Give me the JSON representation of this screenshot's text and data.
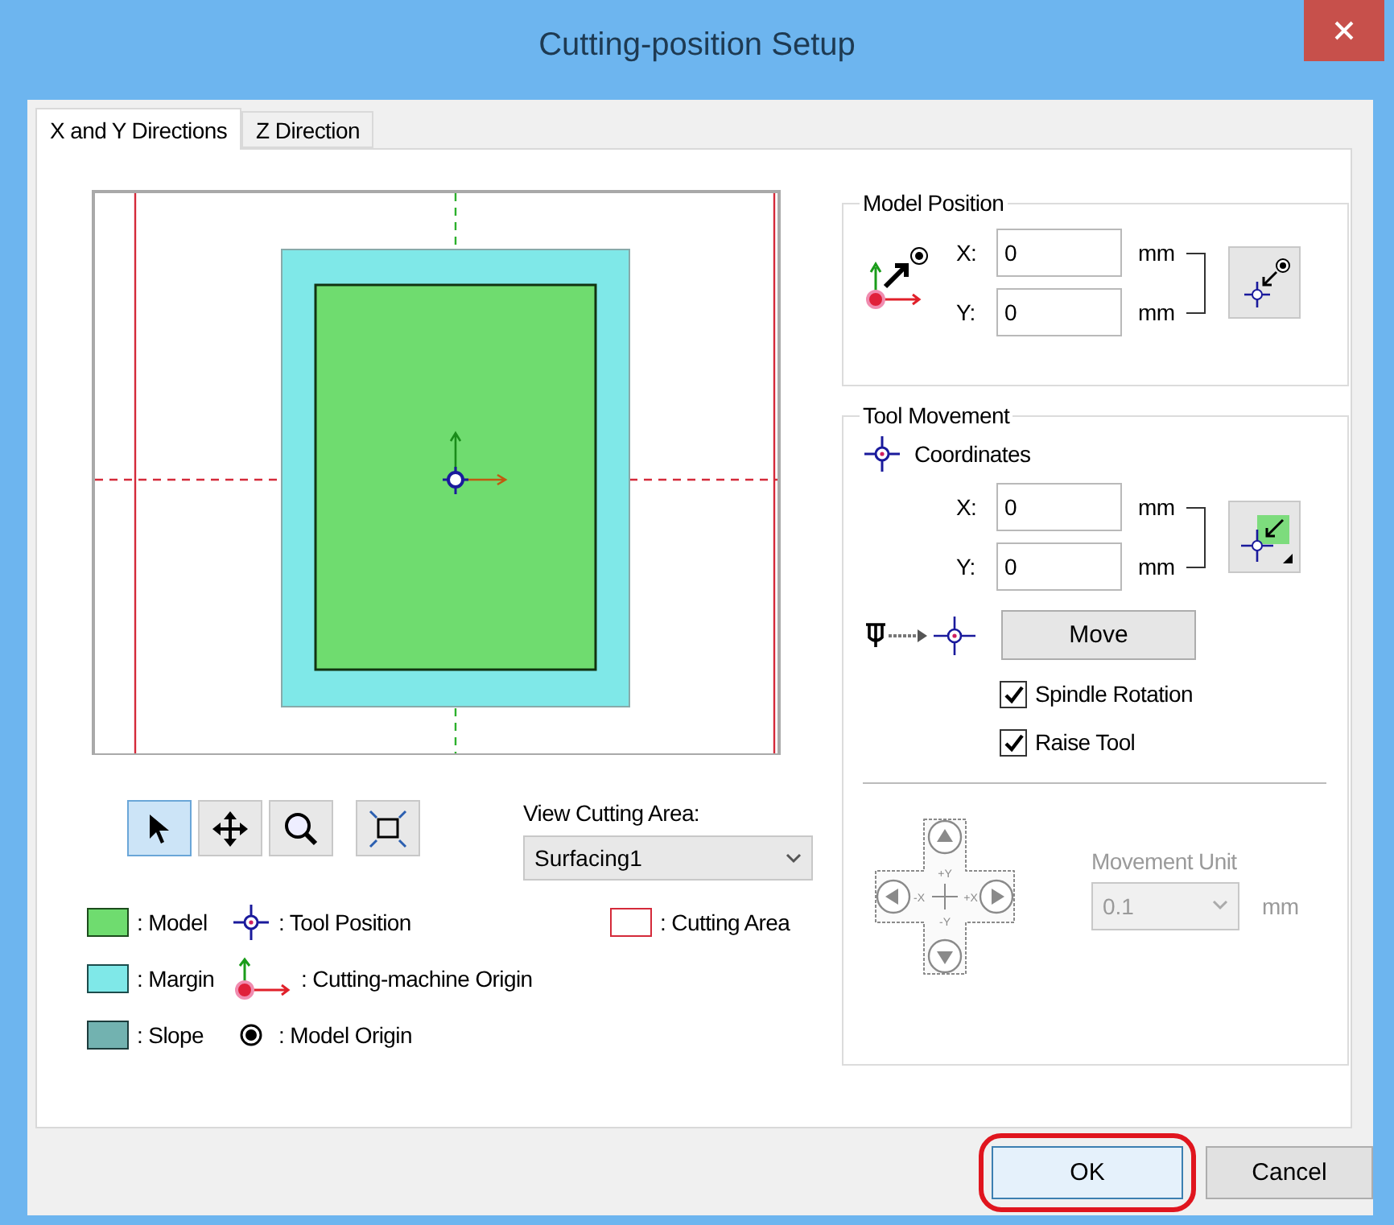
{
  "window": {
    "title": "Cutting-position Setup"
  },
  "tabs": [
    {
      "label": "X and Y Directions",
      "selected": true
    },
    {
      "label": "Z Direction",
      "selected": false
    }
  ],
  "view_tools": [
    {
      "kind": "pointer",
      "selected": true
    },
    {
      "kind": "pan",
      "selected": false
    },
    {
      "kind": "zoom",
      "selected": false
    },
    {
      "kind": "fit",
      "selected": false
    }
  ],
  "view_cutting_area": {
    "label": "View Cutting Area:",
    "value": "Surfacing1"
  },
  "legend": [
    [
      {
        "kind": "model",
        "label": ": Model"
      },
      {
        "kind": "tool_position",
        "label": ": Tool Position"
      },
      {
        "kind": "cutting_area",
        "label": ": Cutting Area"
      }
    ],
    [
      {
        "kind": "margin",
        "label": ": Margin"
      },
      {
        "kind": "machine_origin",
        "label": ": Cutting-machine Origin"
      }
    ],
    [
      {
        "kind": "slope",
        "label": ": Slope"
      },
      {
        "kind": "model_origin",
        "label": ": Model Origin"
      }
    ]
  ],
  "model_position": {
    "title": "Model Position",
    "fields": [
      {
        "label": "X:",
        "value": "0",
        "unit": "mm"
      },
      {
        "label": "Y:",
        "value": "0",
        "unit": "mm"
      }
    ]
  },
  "tool_movement": {
    "title": "Tool Movement",
    "coordinates_label": "Coordinates",
    "fields": [
      {
        "label": "X:",
        "value": "0",
        "unit": "mm"
      },
      {
        "label": "Y:",
        "value": "0",
        "unit": "mm"
      }
    ],
    "move_button": "Move",
    "checkboxes": [
      {
        "label": "Spindle Rotation",
        "checked": true
      },
      {
        "label": "Raise Tool",
        "checked": true
      }
    ],
    "jog": {
      "disabled": true,
      "labels": [
        "+Y",
        "-X",
        "+X",
        "-Y"
      ]
    },
    "movement_unit": {
      "label": "Movement Unit",
      "value": "0.1",
      "unit": "mm",
      "disabled": true
    }
  },
  "buttons": [
    {
      "label": "OK",
      "highlighted": true
    },
    {
      "label": "Cancel",
      "highlighted": false
    }
  ]
}
